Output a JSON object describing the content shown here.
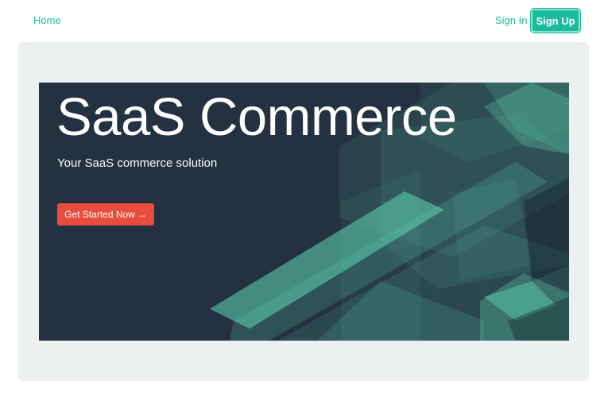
{
  "nav": {
    "home_label": "Home",
    "signin_label": "Sign In",
    "signup_label": "Sign Up"
  },
  "hero": {
    "title": "SaaS Commerce",
    "subtitle": "Your SaaS commerce solution",
    "cta_label": "Get Started Now",
    "cta_icon": "arrow-right-icon"
  },
  "colors": {
    "accent": "#1abc9c",
    "hero_background": "#243140",
    "cta": "#e74c3c",
    "jumbotron": "#ecf0f1"
  }
}
